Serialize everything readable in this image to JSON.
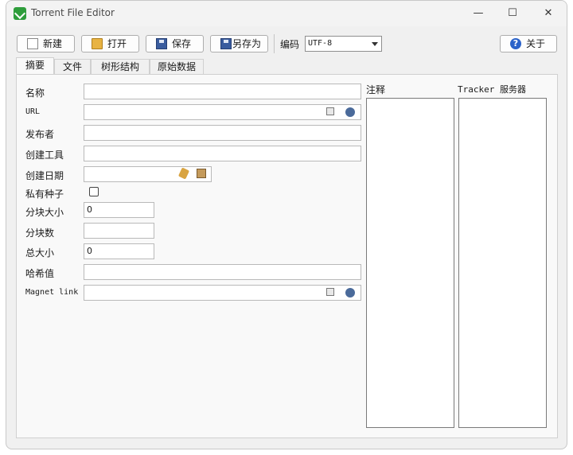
{
  "window": {
    "title": "Torrent File Editor",
    "minimize": "—",
    "maximize": "☐",
    "close": "✕"
  },
  "toolbar": {
    "new_label": "新建",
    "open_label": "打开",
    "save_label": "保存",
    "save_as_label": "另存为",
    "encoding_label": "编码",
    "encoding_value": "UTF-8",
    "about_label": "关于"
  },
  "tabs": [
    "摘要",
    "文件",
    "树形结构",
    "原始数据"
  ],
  "fields": {
    "name_label": "名称",
    "url_label": "URL",
    "publisher_label": "发布者",
    "created_by_label": "创建工具",
    "creation_date_label": "创建日期",
    "private_label": "私有种子",
    "piece_size_label": "分块大小",
    "piece_size_value": "0",
    "piece_count_label": "分块数",
    "piece_count_value": "",
    "total_size_label": "总大小",
    "total_size_value": "0",
    "hash_label": "哈希值",
    "magnet_label": "Magnet link"
  },
  "comments_label": "注释",
  "trackers_label": "Tracker 服务器",
  "colors": {
    "accent": "#2a62c9",
    "app_icon": "#2e9d3b",
    "window_bg": "#f0f0f0"
  }
}
